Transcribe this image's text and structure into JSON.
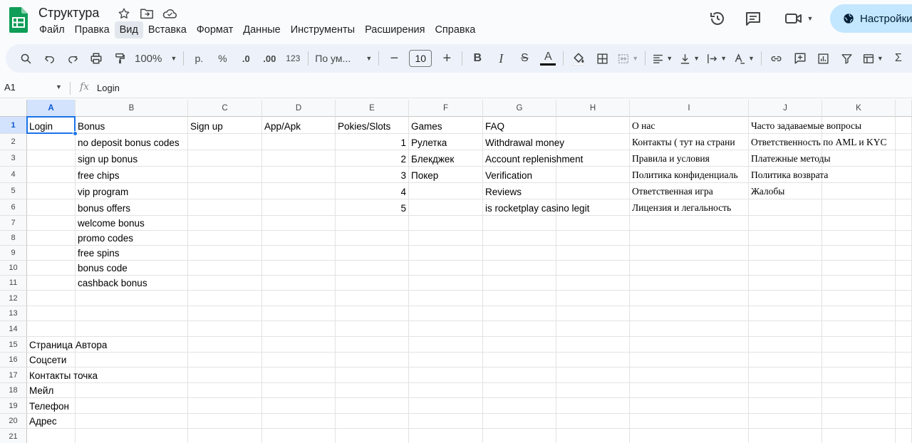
{
  "document": {
    "title": "Структура"
  },
  "menu": [
    "Файл",
    "Правка",
    "Вид",
    "Вставка",
    "Формат",
    "Данные",
    "Инструменты",
    "Расширения",
    "Справка"
  ],
  "active_menu_index": 2,
  "share_label": "Настройки",
  "toolbar": {
    "zoom": "100%",
    "currency": "р.",
    "percent": "%",
    "dec_decrease": ".0",
    "dec_increase": ".00",
    "number_format": "123",
    "font_name": "По ум...",
    "font_size": "10"
  },
  "formula_bar": {
    "cell_ref": "A1",
    "fx": "fx",
    "value": "Login"
  },
  "columns": [
    "A",
    "B",
    "C",
    "D",
    "E",
    "F",
    "G",
    "H",
    "I",
    "J",
    "K"
  ],
  "rows": [
    "1",
    "2",
    "3",
    "4",
    "5",
    "6",
    "7",
    "8",
    "9",
    "10",
    "11",
    "12",
    "13",
    "14",
    "15",
    "16",
    "17",
    "18",
    "19",
    "20",
    "21"
  ],
  "cells": {
    "A1": "Login",
    "B1": "Bonus",
    "C1": "Sign up",
    "D1": "App/Apk",
    "E1": "Pokies/Slots",
    "F1": "Games",
    "G1": "FAQ",
    "I1": "О нас",
    "J1": "Часто задаваемые вопросы",
    "B2": "no deposit bonus codes",
    "E2": "1",
    "F2": "Рулетка",
    "G2": "Withdrawal money",
    "I2": "Контакты ( тут на страни",
    "J2": "Ответственность по AML и KYC",
    "B3": "sign up bonus",
    "E3": "2",
    "F3": "Блекджек",
    "G3": "Account replenishment",
    "I3": "Правила и условия",
    "J3": "Платежные методы",
    "B4": "free chips",
    "E4": "3",
    "F4": "Покер",
    "G4": "Verification",
    "I4": "Политика конфиденциаль",
    "J4": "Политика возврата",
    "B5": "vip program",
    "E5": "4",
    "G5": "Reviews",
    "I5": "Ответственная игра",
    "J5": "Жалобы",
    "B6": "bonus offers",
    "E6": "5",
    "G6": "is rocketplay casino legit",
    "I6": "Лицензия и легальность",
    "B7": "welcome bonus",
    "B8": "promo codes",
    "B9": "free spins",
    "B10": "bonus code",
    "B11": "cashback bonus",
    "A15": "Страница Автора",
    "A16": "Соцсети",
    "A17": "Контакты точка",
    "A18": "Мейл",
    "A19": "Телефон",
    "A20": "Адрес"
  },
  "numeric_cells": [
    "E2",
    "E3",
    "E4",
    "E5",
    "E6"
  ],
  "serif_columns": [
    "I",
    "J"
  ],
  "selected_cell": "A1",
  "colors": {
    "accent": "#1a73e8",
    "share_bg": "#c2e7ff",
    "sheets_green": "#0f9d58"
  }
}
